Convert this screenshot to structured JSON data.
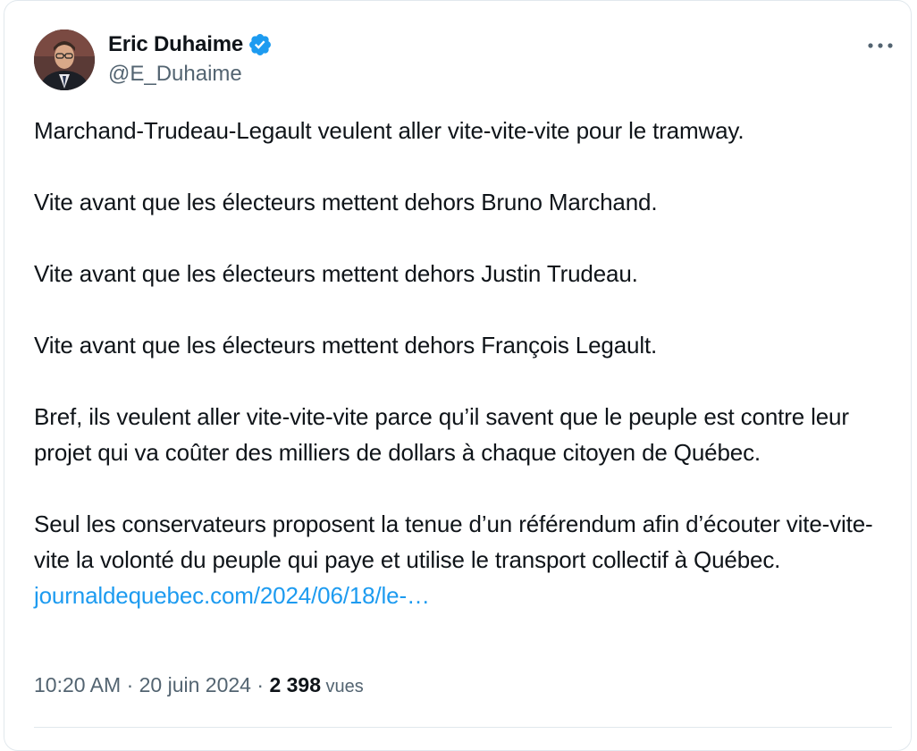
{
  "author": {
    "display_name": "Eric Duhaime",
    "handle": "@E_Duhaime",
    "verified": true,
    "verified_color": "#1d9bf0"
  },
  "tweet": {
    "paragraphs": [
      "Marchand-Trudeau-Legault veulent aller vite-vite-vite pour le tramway.",
      "Vite avant que les électeurs mettent dehors Bruno Marchand.",
      "Vite avant que les électeurs mettent dehors Justin Trudeau.",
      "Vite avant que les électeurs mettent dehors François Legault.",
      "Bref, ils veulent aller vite-vite-vite parce qu’il savent que le peuple est contre leur projet qui va coûter des milliers de dollars à chaque citoyen de Québec."
    ],
    "last_paragraph_text": "Seul les conservateurs proposent la tenue d’un référendum afin d’écouter vite-vite-vite la volonté du peuple qui paye et utilise le transport collectif à Québec. ",
    "link_text": "journaldequebec.com/2024/06/18/le-…",
    "link_color": "#1d9bf0"
  },
  "meta": {
    "time": "10:20 AM",
    "separator": " · ",
    "date": "20 juin 2024",
    "separator2": " · ",
    "views_count": "2 398",
    "views_label": " vues"
  },
  "icons": {
    "more": "more-options-icon",
    "verified": "verified-badge-icon"
  }
}
